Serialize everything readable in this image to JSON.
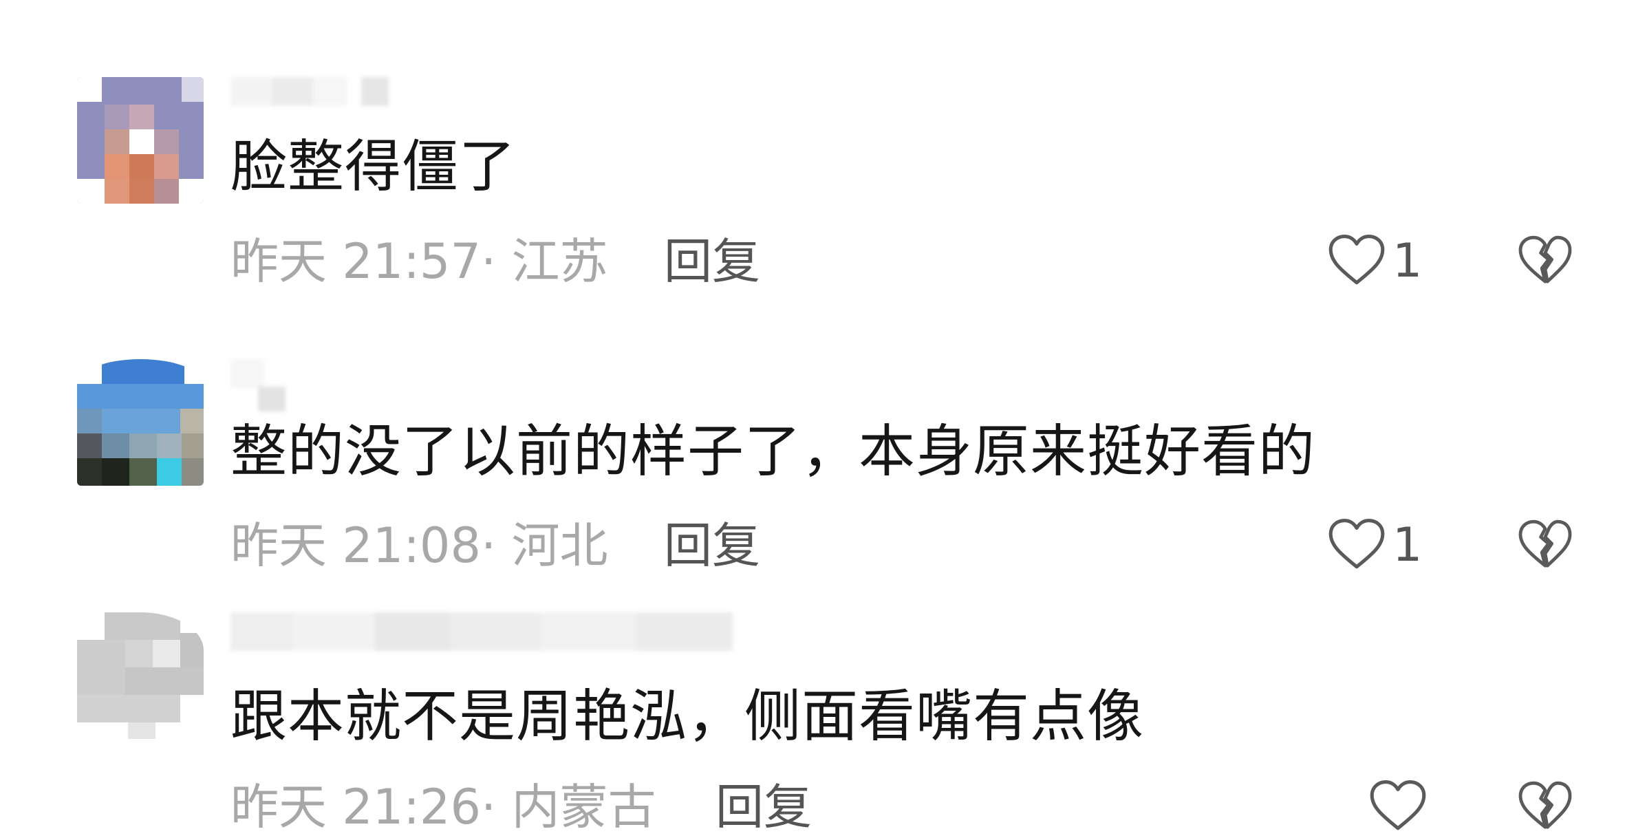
{
  "comments": [
    {
      "text": "脸整得僵了",
      "time": "昨天 21:57",
      "location": "· 江苏",
      "reply_label": "回复",
      "likes": "1"
    },
    {
      "text": "整的没了以前的样子了，本身原来挺好看的",
      "time": "昨天 21:08",
      "location": "· 河北",
      "reply_label": "回复",
      "likes": "1"
    },
    {
      "text": "跟本就不是周艳泓，侧面看嘴有点像",
      "time": "昨天 21:26",
      "location": "· 内蒙古",
      "reply_label": "回复",
      "likes": ""
    }
  ],
  "icons": {
    "like": "heart-outline-icon",
    "dislike": "broken-heart-icon"
  },
  "colors": {
    "text": "#161616",
    "meta": "#a8a8a8",
    "action": "#555555"
  }
}
